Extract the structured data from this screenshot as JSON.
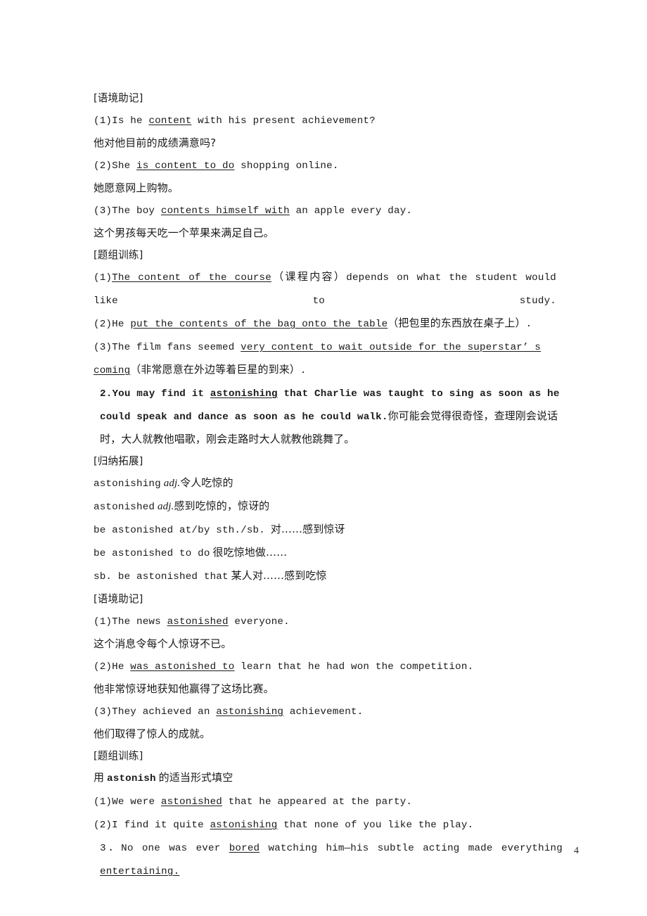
{
  "page": {
    "number": "4",
    "language": "zh-CN + en",
    "text_color": "#1a1a1a",
    "background": "#ffffff"
  },
  "blocks": [
    {
      "id": "h1",
      "kind": "section-heading",
      "text": "[语境助记]"
    },
    {
      "id": "l1",
      "kind": "example-en",
      "text": "(1)Is he content with his present achievement?",
      "underlined": "content"
    },
    {
      "id": "l2",
      "kind": "translation-cn",
      "text": "他对他目前的成绩满意吗?"
    },
    {
      "id": "l3",
      "kind": "example-en",
      "text": "(2)She is content to do shopping online.",
      "underlined": "is content to do"
    },
    {
      "id": "l4",
      "kind": "translation-cn",
      "text": "她愿意网上购物。"
    },
    {
      "id": "l5",
      "kind": "example-en",
      "text": "(3)The boy contents himself with an apple every day.",
      "underlined": "contents himself with"
    },
    {
      "id": "l6",
      "kind": "translation-cn",
      "text": "这个男孩每天吃一个苹果来满足自己。"
    },
    {
      "id": "h2",
      "kind": "section-heading",
      "text": "[题组训练]"
    },
    {
      "id": "l7",
      "kind": "exercise",
      "number": "(1)",
      "underlined": "The content of the course",
      "gloss": "（课程内容）",
      "rest": "depends on what the student would like to study."
    },
    {
      "id": "l8",
      "kind": "exercise",
      "number": "(2)",
      "lead": "He ",
      "underlined": "put the contents of the bag onto the table",
      "gloss": "（把包里的东西放在桌子上）",
      "rest": "."
    },
    {
      "id": "l9",
      "kind": "exercise",
      "number": "(3)",
      "lead": "The film fans seemed ",
      "underlined": "very content to wait outside for the superstar’ s coming",
      "gloss": "（非常愿意在外边等着巨星的到来）",
      "rest": "."
    },
    {
      "id": "item2",
      "kind": "numbered-item",
      "number": "2.",
      "en_part1": "You may find it ",
      "underlined": "astonishing",
      "en_part2": " that Charlie was taught to sing as soon as he could speak and dance as soon as he could walk.",
      "cn": "你可能会觉得很奇怪，查理刚会说话时，大人就教他唱歌，刚会走路时大人就教他跳舞了。"
    },
    {
      "id": "h3",
      "kind": "section-heading",
      "text": "[归纳拓展]"
    },
    {
      "id": "g1",
      "kind": "gloss-entry",
      "term": "astonishing",
      "pos": "adj.",
      "meaning": "令人吃惊的"
    },
    {
      "id": "g2",
      "kind": "gloss-entry",
      "term": "astonished",
      "pos": "adj.",
      "meaning": "感到吃惊的，惊讶的"
    },
    {
      "id": "g3",
      "kind": "gloss-entry",
      "term": "be astonished at/by sth./sb.",
      "pos": "",
      "meaning": "对……感到惊讶"
    },
    {
      "id": "g4",
      "kind": "gloss-entry",
      "term": "be astonished to do",
      "pos": "",
      "meaning": "很吃惊地做……"
    },
    {
      "id": "g5",
      "kind": "gloss-entry",
      "term": "sb. be astonished that",
      "pos": "",
      "meaning": "某人对……感到吃惊"
    },
    {
      "id": "h4",
      "kind": "section-heading",
      "text": "[语境助记]"
    },
    {
      "id": "m1",
      "kind": "example-en",
      "text": "(1)The news astonished everyone.",
      "underlined": "astonished"
    },
    {
      "id": "m2",
      "kind": "translation-cn",
      "text": "这个消息令每个人惊讶不已。"
    },
    {
      "id": "m3",
      "kind": "example-en",
      "text": "(2)He was astonished to learn that he had won the competition.",
      "underlined": "was astonished to"
    },
    {
      "id": "m4",
      "kind": "translation-cn",
      "text": "他非常惊讶地获知他赢得了这场比赛。"
    },
    {
      "id": "m5",
      "kind": "example-en",
      "text": "(3)They achieved an astonishing achievement.",
      "underlined": "astonishing"
    },
    {
      "id": "m6",
      "kind": "translation-cn",
      "text": "他们取得了惊人的成就。"
    },
    {
      "id": "h5",
      "kind": "section-heading",
      "text": "[题组训练]"
    },
    {
      "id": "instr",
      "kind": "instruction",
      "prefix": "用",
      "word": "astonish",
      "suffix": "的适当形式填空"
    },
    {
      "id": "e1",
      "kind": "exercise",
      "number": "(1)",
      "lead": "We were ",
      "underlined": "astonished",
      "rest": " that he appeared at the party."
    },
    {
      "id": "e2",
      "kind": "exercise",
      "number": "(2)",
      "lead": "I find it quite ",
      "underlined": "astonishing",
      "rest": " that none of you like the play."
    },
    {
      "id": "item3",
      "kind": "numbered-item",
      "number": "3．",
      "en_part1": "No one was ever ",
      "underlined1": "bored",
      "en_part2": " watching him—his subtle acting made everything ",
      "underlined2": "entertaining",
      "en_part3": "."
    }
  ],
  "lines": {
    "l1_pre": "(1)Is he ",
    "l1_mid": "content",
    "l1_post": " with his present achievement?",
    "l3_pre": "(2)She ",
    "l3_mid": "is content to do",
    "l3_post": " shopping online.",
    "l5_pre": "(3)The boy ",
    "l5_mid": "contents himself with",
    "l5_post": " an apple every day.",
    "m1_pre": "(1)The news ",
    "m1_mid": "astonished",
    "m1_post": " everyone.",
    "m3_pre": "(2)He ",
    "m3_mid": "was astonished to",
    "m3_post": " learn that he had won the competition.",
    "m5_pre": "(3)They achieved an ",
    "m5_mid": "astonishing",
    "m5_post": " achievement."
  }
}
